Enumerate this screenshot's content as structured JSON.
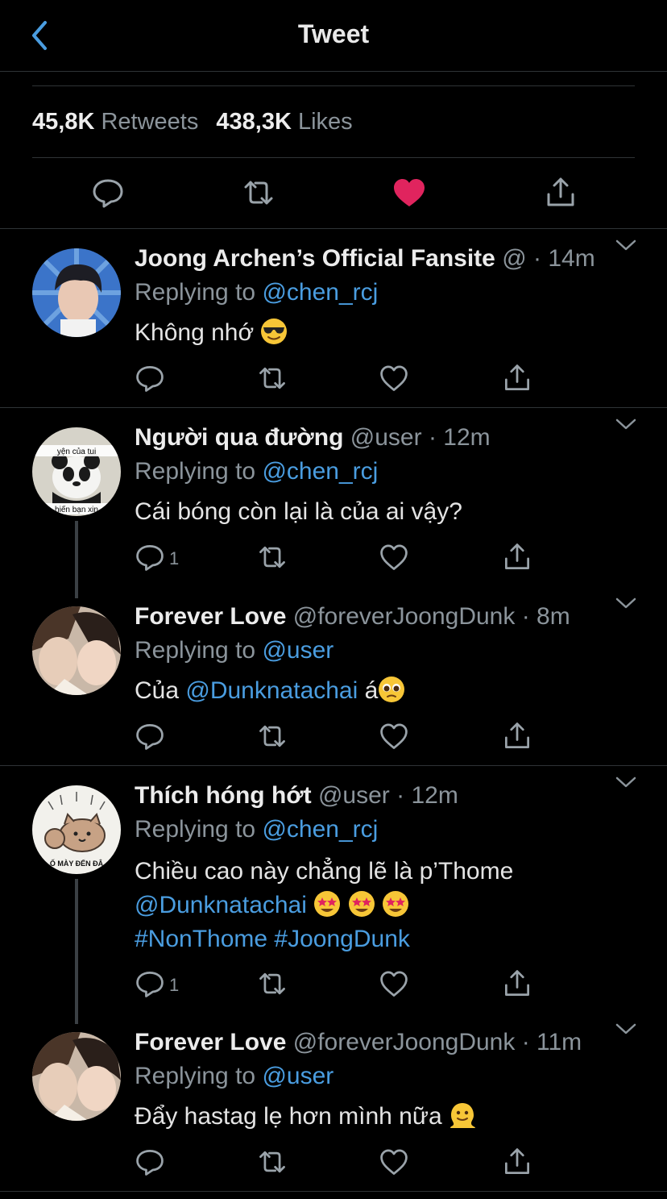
{
  "header": {
    "title": "Tweet"
  },
  "stats": {
    "retweets_count": "45,8K",
    "retweets_label": "Retweets",
    "likes_count": "438,3K",
    "likes_label": "Likes"
  },
  "replies": [
    {
      "name": "Joong Archen’s Official Fansite",
      "handle": "@",
      "time": "· 14m",
      "replying_label": "Replying to",
      "replying_to": "@chen_rcj",
      "text": "Không nhớ",
      "reply_count": ""
    },
    {
      "name": "Người qua đường",
      "handle": "@user",
      "time": "· 12m",
      "replying_label": "Replying to",
      "replying_to": "@chen_rcj",
      "text": "Cái bóng còn lại là của ai vậy?",
      "reply_count": "1",
      "avatar_caption_top": "yện của tui",
      "avatar_caption_bottom": "hiến bạn xin"
    },
    {
      "name": "Forever Love",
      "handle": "@foreverJoongDunk",
      "time": "· 8m",
      "replying_label": "Replying to",
      "replying_to": "@user",
      "text_prefix": "Của ",
      "mention": "@Dunknatachai",
      "text_suffix": " á",
      "reply_count": ""
    },
    {
      "name": "Thích hóng hớt",
      "handle": "@user",
      "time": "· 12m",
      "replying_label": "Replying to",
      "replying_to": "@chen_rcj",
      "text_line1": "Chiều cao này chẳng lẽ là p’Thome",
      "mention": "@Dunknatachai",
      "hashtags": "#NonThome #JoongDunk",
      "reply_count": "1",
      "avatar_caption": "Ố MÀY ĐẾN ĐÂ"
    },
    {
      "name": "Forever Love",
      "handle": "@foreverJoongDunk",
      "time": "· 11m",
      "replying_label": "Replying to",
      "replying_to": "@user",
      "text": "Đẩy hastag lẹ hơn mình nữa",
      "reply_count": ""
    }
  ],
  "colors": {
    "accent": "#4a9de0",
    "like": "#e0245e",
    "muted": "#8b949b",
    "divider": "#2f3336"
  },
  "icons": [
    "back-chevron-icon",
    "reply-icon",
    "retweet-icon",
    "heart-icon",
    "share-icon",
    "chevron-down-icon"
  ]
}
